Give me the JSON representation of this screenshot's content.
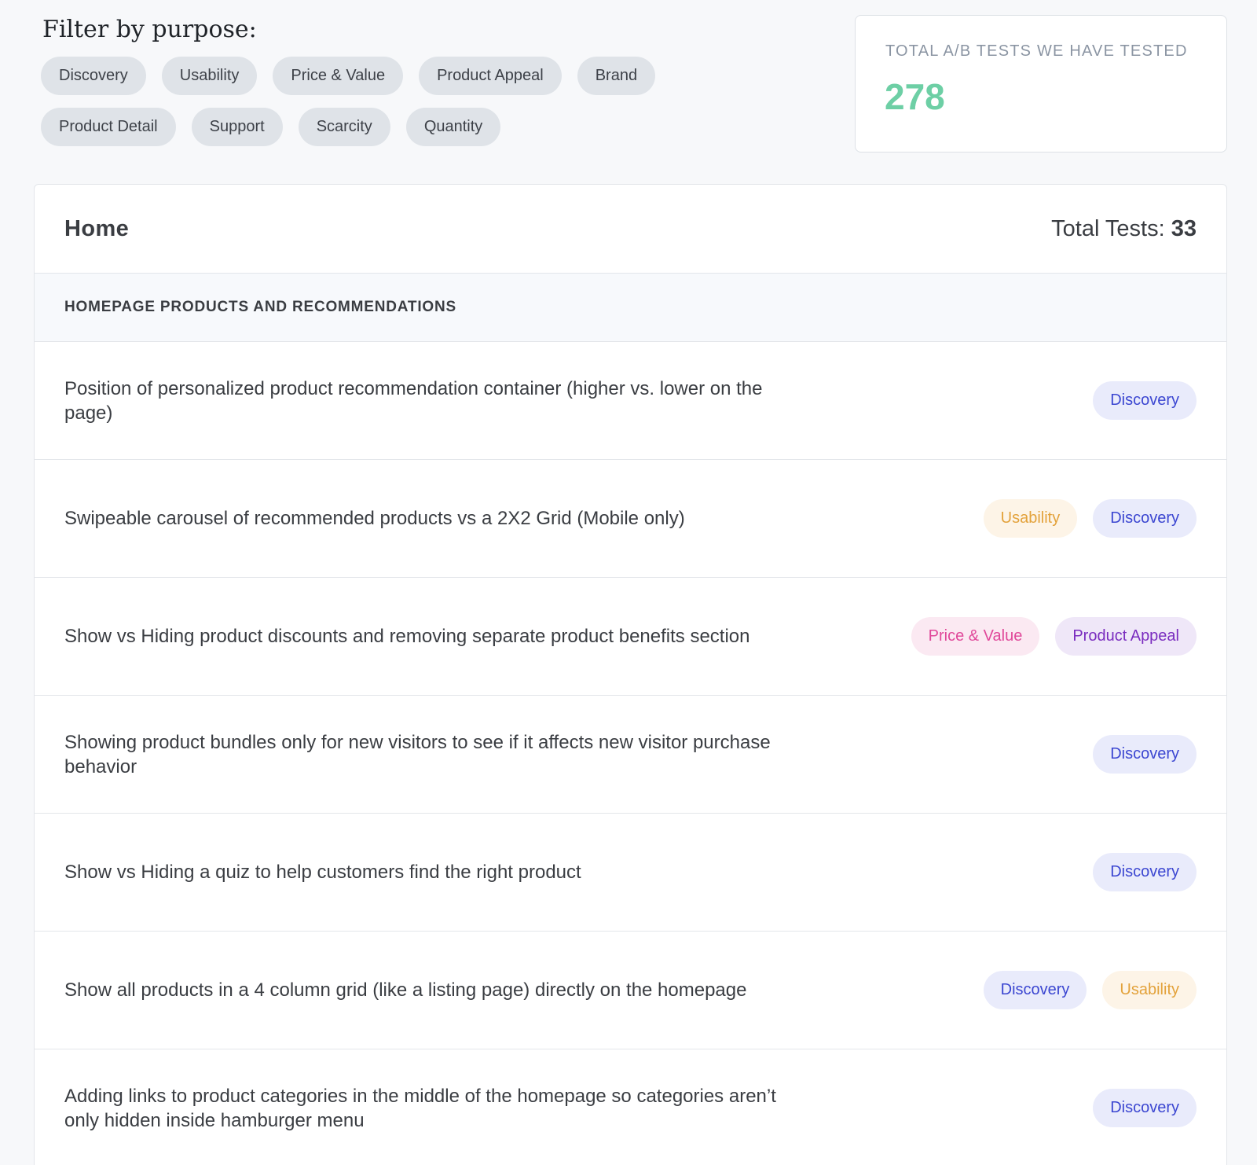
{
  "filter": {
    "title": "Filter by purpose:",
    "chips": [
      "Discovery",
      "Usability",
      "Price & Value",
      "Product Appeal",
      "Brand",
      "Product Detail",
      "Support",
      "Scarcity",
      "Quantity"
    ]
  },
  "stat": {
    "label": "TOTAL A/B TESTS WE HAVE TESTED",
    "value": "278"
  },
  "panel": {
    "title": "Home",
    "total_label": "Total Tests: ",
    "total_value": "33",
    "section_title": "HOMEPAGE PRODUCTS AND RECOMMENDATIONS",
    "rows": [
      {
        "text": "Position of personalized product recommendation container (higher vs. lower on the page)",
        "tags": [
          {
            "label": "Discovery",
            "kind": "discovery"
          }
        ]
      },
      {
        "text": "Swipeable carousel of recommended products vs a 2X2 Grid (Mobile only)",
        "tags": [
          {
            "label": "Usability",
            "kind": "usability"
          },
          {
            "label": "Discovery",
            "kind": "discovery"
          }
        ]
      },
      {
        "text": "Show vs Hiding product discounts and removing separate product benefits section",
        "tags": [
          {
            "label": "Price & Value",
            "kind": "price"
          },
          {
            "label": "Product Appeal",
            "kind": "appeal"
          }
        ]
      },
      {
        "text": "Showing product bundles only for new visitors to see if it affects new visitor purchase behavior",
        "tags": [
          {
            "label": "Discovery",
            "kind": "discovery"
          }
        ]
      },
      {
        "text": "Show vs Hiding a quiz to help customers find the right product",
        "tags": [
          {
            "label": "Discovery",
            "kind": "discovery"
          }
        ]
      },
      {
        "text": "Show all products in a 4 column grid (like a listing page) directly on the homepage",
        "tags": [
          {
            "label": "Discovery",
            "kind": "discovery"
          },
          {
            "label": "Usability",
            "kind": "usability"
          }
        ]
      },
      {
        "text": "Adding links to product categories in the middle of the homepage so categories aren’t only hidden inside hamburger menu",
        "tags": [
          {
            "label": "Discovery",
            "kind": "discovery"
          }
        ]
      }
    ]
  }
}
